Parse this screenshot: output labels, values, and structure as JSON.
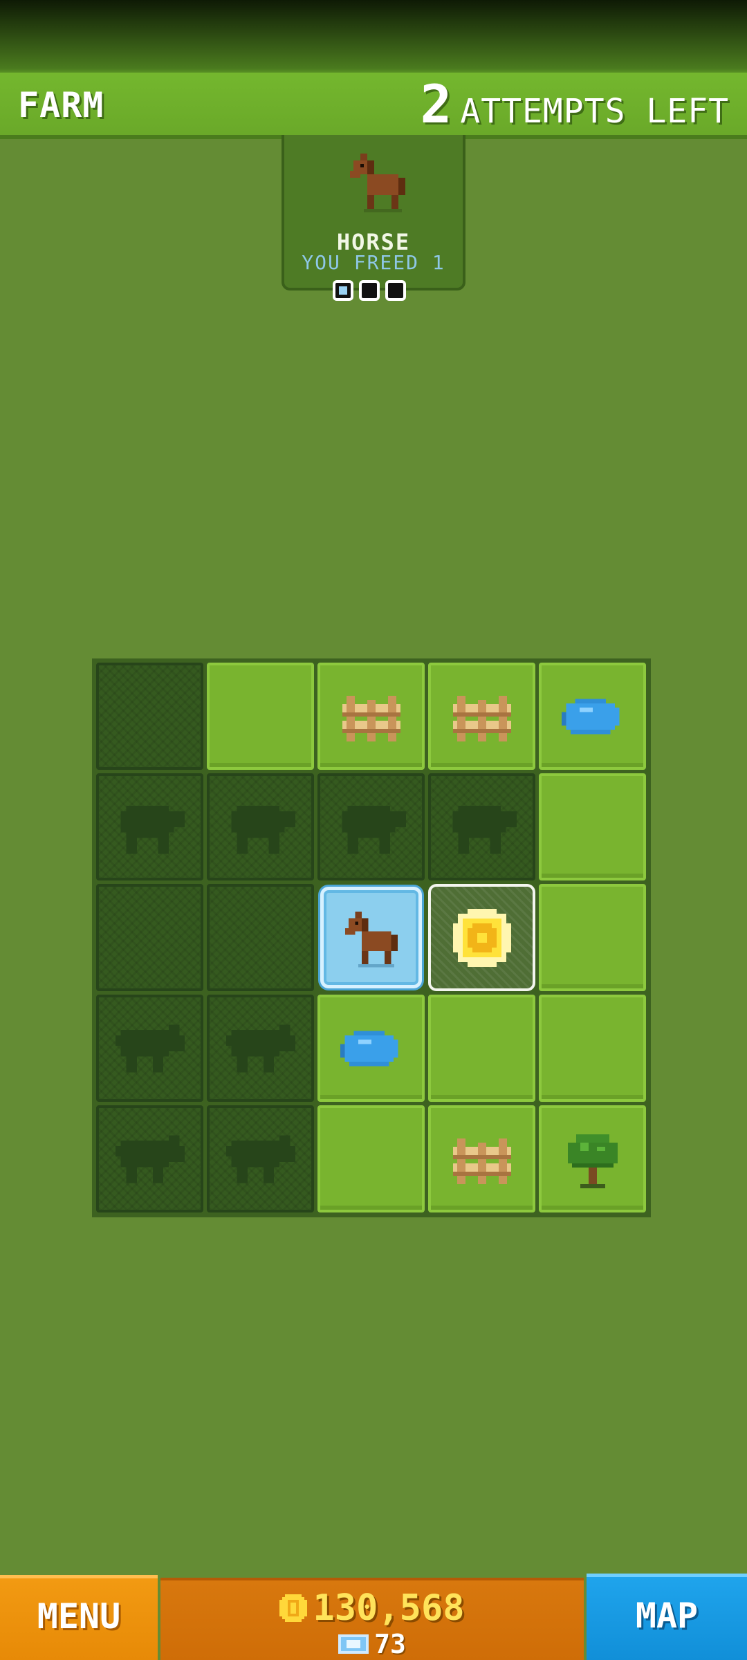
{
  "header": {
    "level_title": "FARM",
    "attempts_count": "2",
    "attempts_label": "ATTEMPTS LEFT"
  },
  "target": {
    "animal_icon": "horse-icon",
    "name": "HORSE",
    "freed_text": "YOU FREED 1",
    "progress": {
      "freed": 1,
      "total": 3
    }
  },
  "board": {
    "rows": 5,
    "cols": 5,
    "tiles": [
      [
        "hidden",
        "grass",
        "fence",
        "fence",
        "pond"
      ],
      [
        "sheep",
        "sheep",
        "sheep",
        "sheep",
        "grass"
      ],
      [
        "hidden",
        "hidden",
        "horse",
        "coin",
        "grass"
      ],
      [
        "pig",
        "pig",
        "pond",
        "grass",
        "grass"
      ],
      [
        "pig",
        "pig",
        "grass",
        "fence",
        "tree"
      ]
    ]
  },
  "footer": {
    "menu_label": "MENU",
    "coins": "130,568",
    "gems": "73",
    "map_label": "MAP"
  },
  "colors": {
    "background": "#648c34",
    "header": "#6aa929",
    "menu_button": "#f29a12",
    "map_button": "#1fa4ec",
    "coin_text": "#ffe35a"
  }
}
